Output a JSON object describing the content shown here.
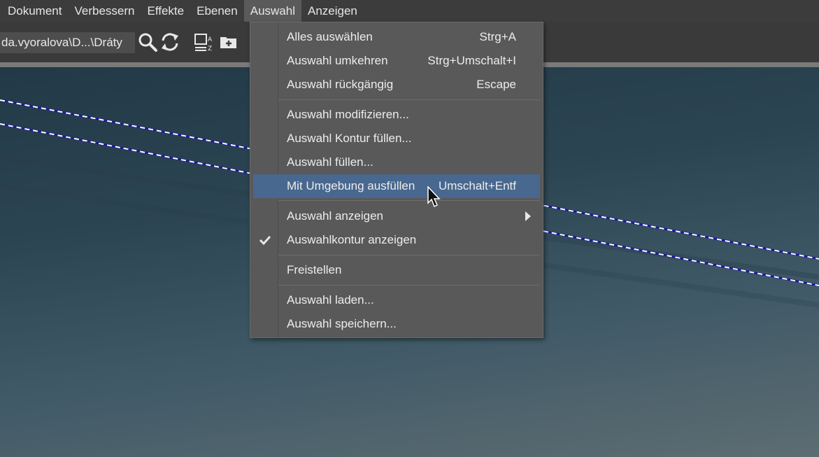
{
  "menubar": {
    "items": [
      {
        "label": "Dokument"
      },
      {
        "label": "Verbessern"
      },
      {
        "label": "Effekte"
      },
      {
        "label": "Ebenen"
      },
      {
        "label": "Auswahl"
      },
      {
        "label": "Anzeigen"
      }
    ]
  },
  "toolbar": {
    "path": "da.vyoralova\\D...\\Dráty",
    "icons": [
      "search-icon",
      "refresh-icon",
      "sort-icon",
      "new-folder-icon"
    ]
  },
  "menu": {
    "items": [
      {
        "label": "Alles auswählen",
        "shortcut": "Strg+A"
      },
      {
        "label": "Auswahl umkehren",
        "shortcut": "Strg+Umschalt+I"
      },
      {
        "label": "Auswahl rückgängig",
        "shortcut": "Escape"
      },
      {
        "label": "Auswahl modifizieren..."
      },
      {
        "label": "Auswahl Kontur füllen..."
      },
      {
        "label": "Auswahl füllen..."
      },
      {
        "label": "Mit Umgebung ausfüllen",
        "shortcut": "Umschalt+Entf",
        "highlighted": true
      },
      {
        "label": "Auswahl anzeigen",
        "submenu": true
      },
      {
        "label": "Auswahlkontur anzeigen",
        "checked": true
      },
      {
        "label": "Freistellen"
      },
      {
        "label": "Auswahl laden..."
      },
      {
        "label": "Auswahl speichern..."
      }
    ]
  },
  "colors": {
    "highlight": "#48688f",
    "selection_marquee": "#1c1c9a"
  }
}
